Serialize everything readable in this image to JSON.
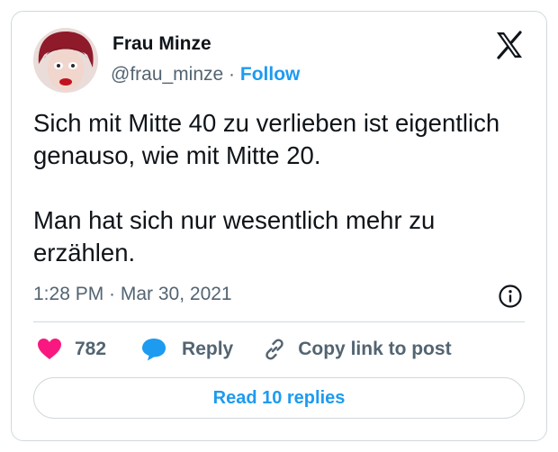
{
  "author": {
    "display_name": "Frau Minze",
    "handle": "@frau_minze",
    "separator": "·",
    "follow_label": "Follow"
  },
  "tweet": {
    "paragraphs": [
      "Sich mit Mitte 40 zu verlieben ist eigentlich genauso, wie mit Mitte 20.",
      "Man hat sich nur wesentlich mehr zu erzählen."
    ],
    "timestamp": "1:28 PM · Mar 30, 2021"
  },
  "actions": {
    "like_count": "782",
    "reply_label": "Reply",
    "copy_link_label": "Copy link to post"
  },
  "read_replies_label": "Read 10 replies",
  "icons": {
    "brand": "x-logo-icon",
    "info": "info-icon",
    "like": "heart-icon",
    "reply": "speech-bubble-icon",
    "copy": "link-icon"
  },
  "colors": {
    "accent": "#1d9bf0",
    "like": "#f91880",
    "text": "#0f1419",
    "muted": "#536471",
    "border": "#cfd9de"
  }
}
